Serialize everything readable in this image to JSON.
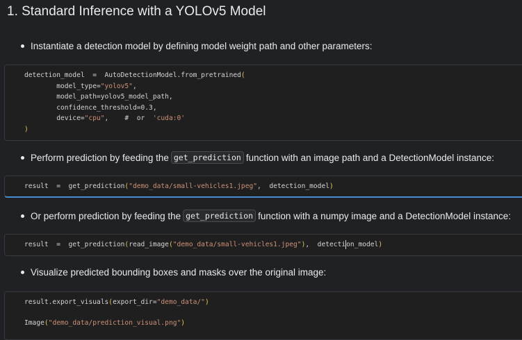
{
  "heading": "1. Standard Inference with a YOLOv5 Model",
  "bullets": {
    "b1": "Instantiate a detection model by defining model weight path and other parameters:",
    "b2_pre": "Perform prediction by feeding the",
    "b2_code": "get_prediction",
    "b2_post": "function with an image path and a DetectionModel instance:",
    "b3_pre": "Or perform prediction by feeding the",
    "b3_code": "get_prediction",
    "b3_post": "function with a numpy image and a DetectionModel instance:",
    "b4": "Visualize predicted bounding boxes and masks over the original image:"
  },
  "cell1": {
    "l1_a": "detection_model  =  AutoDetectionModel.from_pretrained",
    "l1_b": "(",
    "l2_a": "        model_type=",
    "l2_b": "\"yolov5\"",
    "l2_c": ",",
    "l3": "        model_path=yolov5_model_path,",
    "l4": "        confidence_threshold=0.3,",
    "l5_a": "        device=",
    "l5_b": "\"cpu\"",
    "l5_c": ",    #  or  ",
    "l5_d": "'cuda:0'",
    "l6": ")"
  },
  "cell2": {
    "a": "result  =  get_prediction",
    "b": "(",
    "c": "\"demo_data/small-vehicles1.jpeg\"",
    "d": ",  detection_model",
    "e": ")"
  },
  "cell3": {
    "a": "result  =  get_prediction",
    "b": "(",
    "c": "read_image",
    "d": "(",
    "e": "\"demo_data/small-vehicles1.jpeg\"",
    "f": ")",
    "g": ",  detecti",
    "h": "on_model",
    "i": ")"
  },
  "cell4": {
    "l1_a": "result.export_visuals",
    "l1_b": "(",
    "l1_c": "export_dir=",
    "l1_d": "\"demo_data/\"",
    "l1_e": ")",
    "l2_a": "Image",
    "l2_b": "(",
    "l2_c": "\"demo_data/prediction_visual.png\"",
    "l2_d": ")"
  }
}
